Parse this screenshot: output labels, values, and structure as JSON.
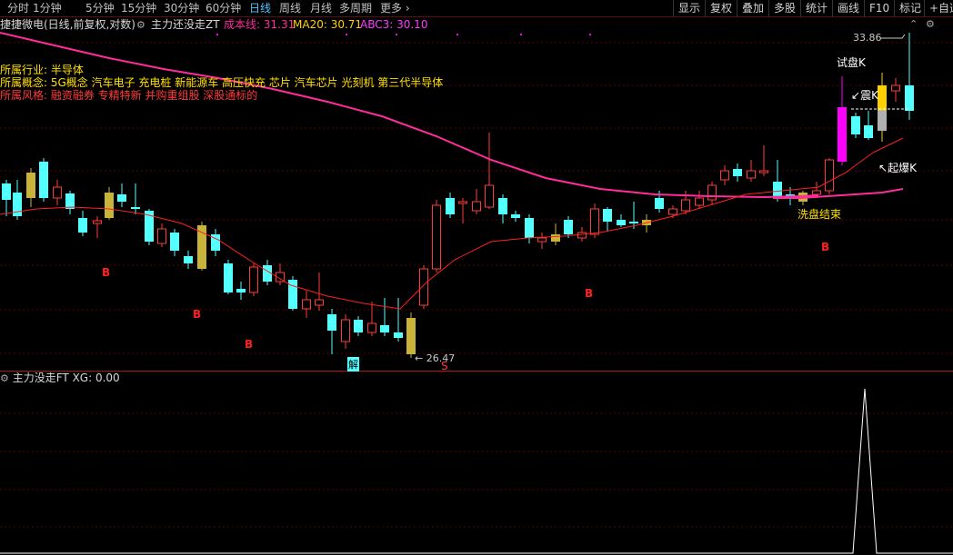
{
  "toolbar": {
    "periods": [
      "分时",
      "1分钟",
      "5分钟",
      "15分钟",
      "30分钟",
      "60分钟",
      "日线",
      "周线",
      "月线",
      "多周期",
      "更多"
    ],
    "active_period": "日线",
    "right_buttons": [
      "显示",
      "复权",
      "叠加",
      "多股",
      "统计",
      "画线",
      "F10",
      "标记",
      "+自选"
    ]
  },
  "main_panel": {
    "title": "捷捷微电(日线,前复权,对数)",
    "indicator_name": "主力还没走ZT",
    "cost_line": "成本线: 31.31",
    "ma20": "MA20: 30.71",
    "abc3": "ABC3: 30.10",
    "industry": "所属行业: 半导体",
    "concepts": "所属概念: 5G概念 汽车电子 充电桩 新能源车 高压快充 芯片 汽车芯片 光刻机 第三代半导体",
    "style": "所属风格: 融资融券 专精特新 并购重组股 深股通标的",
    "price_high": "33.86",
    "price_low": "26.47",
    "labels": {
      "try_k": "试盘K",
      "shock_k": "震K",
      "explode_k": "起爆K",
      "wash_end": "洗盘结束",
      "jie": "解",
      "s": "S",
      "b": "B"
    },
    "colors": {
      "up": "#ff3a3a",
      "down": "#54ffff",
      "ma": "#ff2020",
      "cost": "#ff2c9c",
      "gold": "#c8b43a",
      "magenta": "#ff00ff",
      "yellow": "#ffd000"
    }
  },
  "sub_panel": {
    "title": "主力没走FT",
    "xg_value": "XG: 0.00"
  }
}
